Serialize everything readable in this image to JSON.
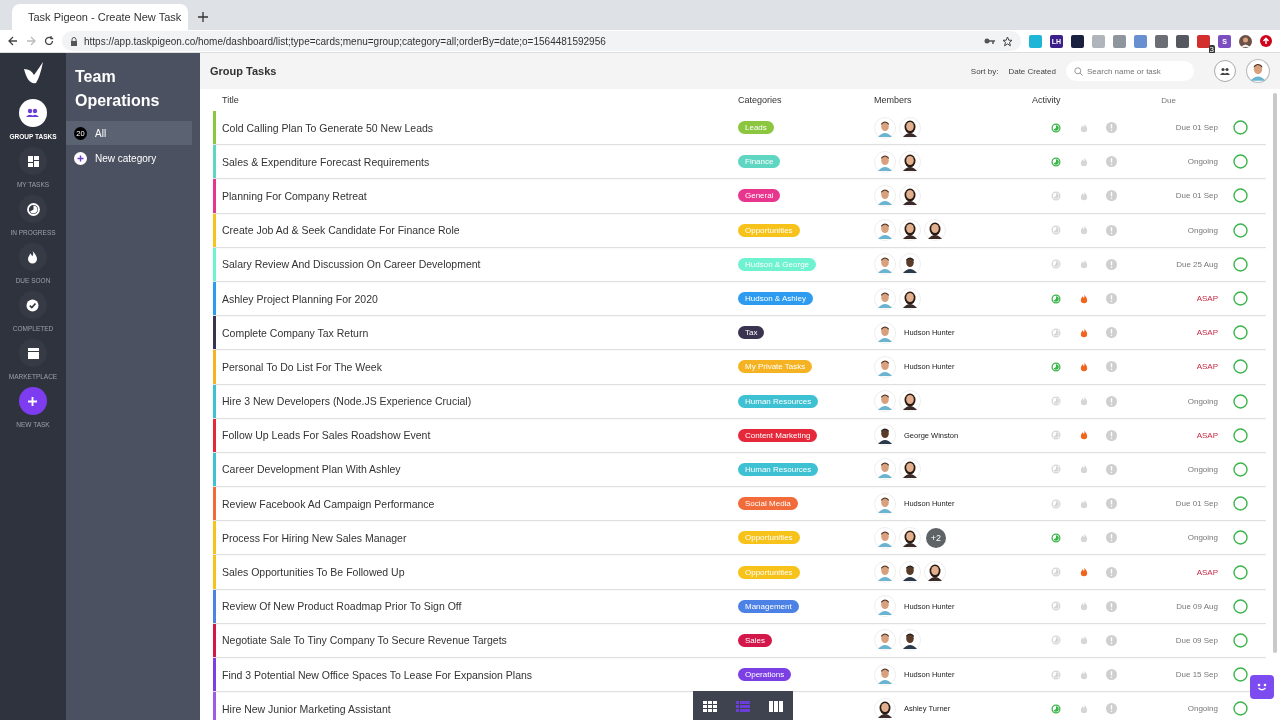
{
  "browser": {
    "tab_title": "Task Pigeon - Create New Task",
    "url": "https://app.taskpigeon.co/home/dashboard/list;type=cards;menu=group;category=all;orderBy=date;o=1564481592956",
    "extensions": [
      {
        "color": "#1fb5d6"
      },
      {
        "label": "LH",
        "color": "#3b1f8a"
      },
      {
        "color": "#1a2140"
      },
      {
        "color": "#b0b4bb"
      },
      {
        "color": "#8f959c"
      },
      {
        "color": "#6a8fd0"
      },
      {
        "color": "#6b6f75"
      },
      {
        "color": "#55595f"
      },
      {
        "color": "#d32f2f",
        "badge": "3"
      },
      {
        "label": "S",
        "color": "#7b4fc0"
      }
    ]
  },
  "rail": [
    {
      "kind": "group",
      "label": "GROUP TASKS",
      "selected": true
    },
    {
      "kind": "grid",
      "label": "MY TASKS",
      "selected": false
    },
    {
      "kind": "progress",
      "label": "IN PROGRESS",
      "selected": false
    },
    {
      "kind": "flame",
      "label": "DUE SOON",
      "selected": false
    },
    {
      "kind": "check",
      "label": "COMPLETED",
      "selected": false
    },
    {
      "kind": "store",
      "label": "MARKETPLACE",
      "selected": false
    },
    {
      "kind": "new",
      "label": "NEW TASK",
      "selected": false
    }
  ],
  "panel": {
    "title": "Team Operations",
    "items": [
      {
        "kind": "count",
        "count": "20",
        "label": "All",
        "selected": true
      },
      {
        "kind": "add",
        "label": "New category",
        "selected": false
      }
    ]
  },
  "header": {
    "title": "Group Tasks",
    "sort_label": "Sort by:",
    "sort_value": "Date Created",
    "search": {
      "placeholder": "Search name or task"
    }
  },
  "columns": [
    "Title",
    "Categories",
    "Members",
    "Activity",
    "Due"
  ],
  "rows": [
    {
      "title": "Cold Calling Plan To Generate 50 New Leads",
      "category": "Leads",
      "color": "#8cc63f",
      "members": [
        {
          "kind": "man"
        },
        {
          "kind": "woman"
        }
      ],
      "in_progress": true,
      "hot": false,
      "due": "Due 01 Sep",
      "urgent": false
    },
    {
      "title": "Sales & Expenditure Forecast Requirements",
      "category": "Finance",
      "color": "#5ed6c1",
      "members": [
        {
          "kind": "man"
        },
        {
          "kind": "woman"
        }
      ],
      "in_progress": true,
      "hot": false,
      "due": "Ongoing",
      "urgent": false
    },
    {
      "title": "Planning For Company Retreat",
      "category": "General",
      "color": "#e8368f",
      "members": [
        {
          "kind": "man"
        },
        {
          "kind": "woman"
        }
      ],
      "in_progress": false,
      "hot": false,
      "due": "Due 01 Sep",
      "urgent": false
    },
    {
      "title": "Create Job Ad & Seek Candidate For Finance Role",
      "category": "Opportunities",
      "color": "#f7c21a",
      "members": [
        {
          "kind": "man"
        },
        {
          "kind": "woman"
        },
        {
          "kind": "woman"
        }
      ],
      "in_progress": false,
      "hot": false,
      "due": "Ongoing",
      "urgent": false
    },
    {
      "title": "Salary Review And Discussion On Career Development",
      "category": "Hudson & George",
      "color": "#6ef2cf",
      "members": [
        {
          "kind": "man"
        },
        {
          "kind": "man-dark"
        }
      ],
      "in_progress": false,
      "hot": false,
      "due": "Due 25 Aug",
      "urgent": false
    },
    {
      "title": "Ashley Project Planning For 2020",
      "category": "Hudson & Ashley",
      "color": "#2d9cf0",
      "members": [
        {
          "kind": "man"
        },
        {
          "kind": "woman"
        }
      ],
      "in_progress": true,
      "hot": true,
      "due": "ASAP",
      "urgent": true
    },
    {
      "title": "Complete Company Tax Return",
      "category": "Tax",
      "color": "#3b3451",
      "members": [
        {
          "kind": "man"
        }
      ],
      "member_name": "Hudson Hunter",
      "in_progress": false,
      "hot": true,
      "due": "ASAP",
      "urgent": true
    },
    {
      "title": "Personal To Do List For The Week",
      "category": "My Private Tasks",
      "color": "#f5b323",
      "members": [
        {
          "kind": "man"
        }
      ],
      "member_name": "Hudson Hunter",
      "in_progress": true,
      "hot": true,
      "due": "ASAP",
      "urgent": true
    },
    {
      "title": "Hire 3 New Developers (Node.JS Experience Crucial)",
      "category": "Human Resources",
      "color": "#3ec1d3",
      "members": [
        {
          "kind": "man"
        },
        {
          "kind": "woman"
        }
      ],
      "in_progress": false,
      "hot": false,
      "due": "Ongoing",
      "urgent": false
    },
    {
      "title": "Follow Up Leads For Sales Roadshow Event",
      "category": "Content Marketing",
      "color": "#e5293a",
      "members": [
        {
          "kind": "man-dark"
        }
      ],
      "member_name": "George Winston",
      "in_progress": false,
      "hot": true,
      "due": "ASAP",
      "urgent": true
    },
    {
      "title": "Career Development Plan With Ashley",
      "category": "Human Resources",
      "color": "#3ec1d3",
      "members": [
        {
          "kind": "man"
        },
        {
          "kind": "woman"
        }
      ],
      "in_progress": false,
      "hot": false,
      "due": "Ongoing",
      "urgent": false
    },
    {
      "title": "Review Facebook Ad Campaign Performance",
      "category": "Social Media",
      "color": "#f26b3a",
      "members": [
        {
          "kind": "man"
        }
      ],
      "member_name": "Hudson Hunter",
      "in_progress": false,
      "hot": false,
      "due": "Due 01 Sep",
      "urgent": false
    },
    {
      "title": "Process For Hiring New Sales Manager",
      "category": "Opportunities",
      "color": "#f7c21a",
      "members": [
        {
          "kind": "man"
        },
        {
          "kind": "woman"
        }
      ],
      "more": "+2",
      "in_progress": true,
      "hot": false,
      "due": "Ongoing",
      "urgent": false
    },
    {
      "title": "Sales Opportunities To Be Followed Up",
      "category": "Opportunities",
      "color": "#f7c21a",
      "members": [
        {
          "kind": "man"
        },
        {
          "kind": "man-dark"
        },
        {
          "kind": "woman"
        }
      ],
      "in_progress": false,
      "hot": true,
      "due": "ASAP",
      "urgent": true
    },
    {
      "title": "Review Of New Product Roadmap Prior To Sign Off",
      "category": "Management",
      "color": "#4c82e6",
      "members": [
        {
          "kind": "man"
        }
      ],
      "member_name": "Hudson Hunter",
      "in_progress": false,
      "hot": false,
      "due": "Due 09 Aug",
      "urgent": false
    },
    {
      "title": "Negotiate Sale To Tiny Company To Secure Revenue Targets",
      "category": "Sales",
      "color": "#d4174a",
      "members": [
        {
          "kind": "man"
        },
        {
          "kind": "man-dark"
        }
      ],
      "in_progress": false,
      "hot": false,
      "due": "Due 09 Sep",
      "urgent": false
    },
    {
      "title": "Find 3 Potential New Office Spaces To Lease For Expansion Plans",
      "category": "Operations",
      "color": "#7b3fe4",
      "members": [
        {
          "kind": "man"
        }
      ],
      "member_name": "Hudson Hunter",
      "in_progress": false,
      "hot": false,
      "due": "Due 15 Sep",
      "urgent": false
    },
    {
      "title": "Hire New Junior Marketing Assistant",
      "color": "#9b5de5",
      "members": [
        {
          "kind": "woman"
        }
      ],
      "member_name": "Ashley Turner",
      "in_progress": true,
      "hot": false,
      "due": "Ongoing",
      "urgent": false
    }
  ],
  "view_switcher": [
    {
      "kind": "grid",
      "selected": false
    },
    {
      "kind": "list",
      "selected": true
    },
    {
      "kind": "columns",
      "selected": false
    }
  ]
}
